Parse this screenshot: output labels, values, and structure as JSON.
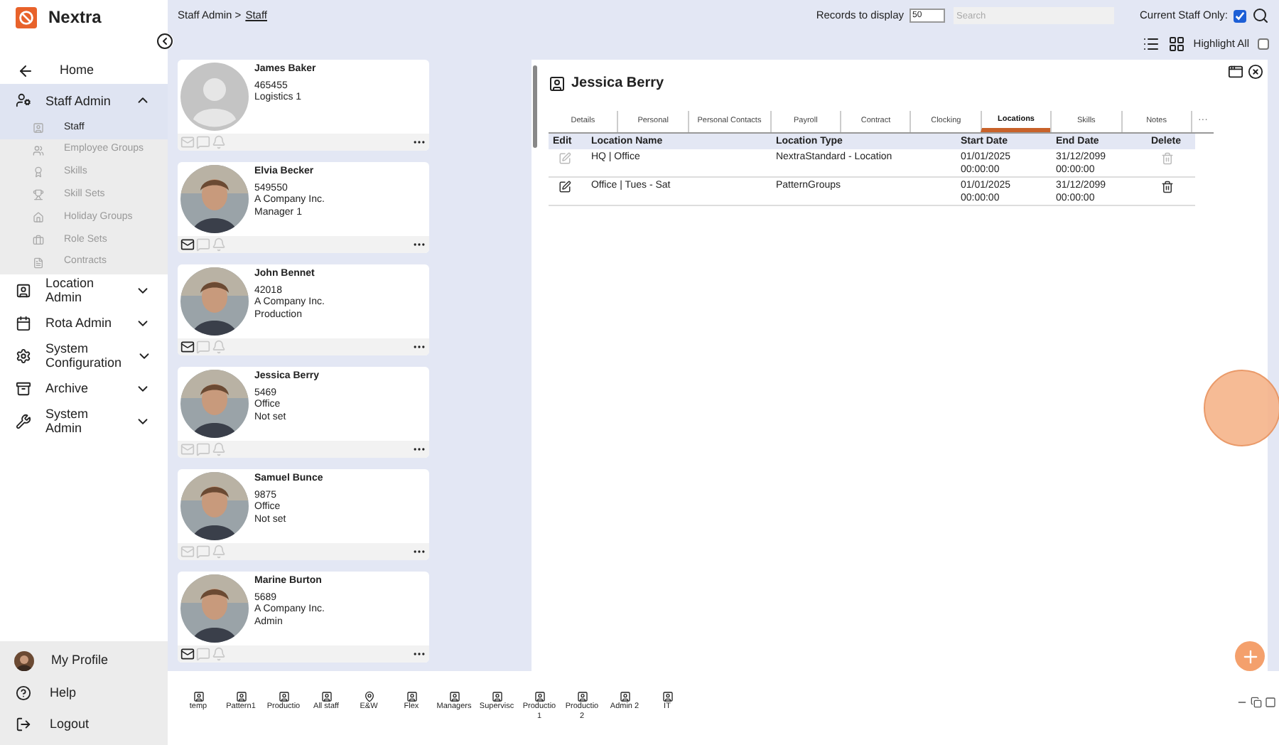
{
  "brand": {
    "name": "Nextra"
  },
  "sidebar": {
    "items": [
      {
        "label": "Home",
        "kind": "back"
      },
      {
        "label": "Staff Admin",
        "kind": "group",
        "expanded": true,
        "children": [
          {
            "label": "Staff",
            "selected": true
          },
          {
            "label": "Employee Groups",
            "selected": false
          },
          {
            "label": "Skills",
            "selected": false
          },
          {
            "label": "Skill Sets",
            "selected": false
          },
          {
            "label": "Holiday Groups",
            "selected": false
          },
          {
            "label": "Role Sets",
            "selected": false
          },
          {
            "label": "Contracts",
            "selected": false
          }
        ]
      },
      {
        "label": "Location Admin",
        "kind": "group",
        "expanded": false
      },
      {
        "label": "Rota Admin",
        "kind": "group",
        "expanded": false
      },
      {
        "label": "System Configuration",
        "kind": "group",
        "expanded": false
      },
      {
        "label": "Archive",
        "kind": "group",
        "expanded": false
      },
      {
        "label": "System Admin",
        "kind": "group",
        "expanded": false
      }
    ],
    "footer": [
      {
        "label": "My Profile",
        "kind": "profile"
      },
      {
        "label": "Help",
        "kind": "help"
      },
      {
        "label": "Logout",
        "kind": "logout"
      }
    ]
  },
  "breadcrumb": {
    "parent": "Staff Admin >",
    "current": "Staff"
  },
  "toolbar": {
    "records_label": "Records to display",
    "records_value": "50",
    "search_placeholder": "Search",
    "current_staff_label": "Current Staff Only:",
    "current_staff_checked": true,
    "highlight_label": "Highlight All",
    "highlight_checked": false
  },
  "staff_cards": [
    {
      "name": "James Baker",
      "lines": [
        "465455",
        "Logistics 1"
      ],
      "kind": "placeholder",
      "email_enabled": false
    },
    {
      "name": "Elvia Becker",
      "lines": [
        "549550",
        "A Company Inc.",
        "Manager 1"
      ],
      "kind": "picture",
      "email_enabled": true
    },
    {
      "name": "John Bennet",
      "lines": [
        "42018",
        "A Company Inc.",
        "Production"
      ],
      "kind": "picture",
      "email_enabled": true
    },
    {
      "name": "Jessica Berry",
      "lines": [
        "5469",
        "Office",
        "Not set"
      ],
      "kind": "picture",
      "email_enabled": false
    },
    {
      "name": "Samuel Bunce",
      "lines": [
        "9875",
        "Office",
        "Not set"
      ],
      "kind": "picture",
      "email_enabled": false
    },
    {
      "name": "Marine Burton",
      "lines": [
        "5689",
        "A Company Inc.",
        "Admin"
      ],
      "kind": "picture",
      "email_enabled": true
    }
  ],
  "detail": {
    "title": "Jessica Berry",
    "tabs": [
      {
        "label": "Details",
        "selected": false
      },
      {
        "label": "Personal",
        "selected": false
      },
      {
        "label": "Personal Contacts",
        "selected": false
      },
      {
        "label": "Payroll",
        "selected": false
      },
      {
        "label": "Contract",
        "selected": false
      },
      {
        "label": "Clocking",
        "selected": false
      },
      {
        "label": "Locations",
        "selected": true
      },
      {
        "label": "Skills",
        "selected": false
      },
      {
        "label": "Notes",
        "selected": false
      }
    ],
    "more_tabs": "···",
    "table": {
      "columns": [
        "Edit",
        "Location Name",
        "Location Type",
        "Start Date",
        "End Date",
        "Delete"
      ],
      "rows": [
        {
          "editable": false,
          "location_name": "HQ | Office",
          "location_type": "NextraStandard - Location",
          "start_date": "01/01/2025 00:00:00",
          "end_date": "31/12/2099 00:00:00"
        },
        {
          "editable": true,
          "location_name": "Office | Tues - Sat",
          "location_type": "PatternGroups",
          "start_date": "01/01/2025 00:00:00",
          "end_date": "31/12/2099 00:00:00"
        }
      ]
    }
  },
  "groups": [
    {
      "label": "temp",
      "kind": "group"
    },
    {
      "label": "Pattern1",
      "kind": "group"
    },
    {
      "label": "Productio",
      "kind": "group"
    },
    {
      "label": "All staff",
      "kind": "group"
    },
    {
      "label": "E&W",
      "kind": "location"
    },
    {
      "label": "Flex",
      "kind": "group"
    },
    {
      "label": "Managers",
      "kind": "group"
    },
    {
      "label": "Supervisc",
      "kind": "group"
    },
    {
      "label": "Productio 1",
      "kind": "group"
    },
    {
      "label": "Productio 2",
      "kind": "group"
    },
    {
      "label": "Admin 2",
      "kind": "group"
    },
    {
      "label": "IT",
      "kind": "group"
    }
  ]
}
